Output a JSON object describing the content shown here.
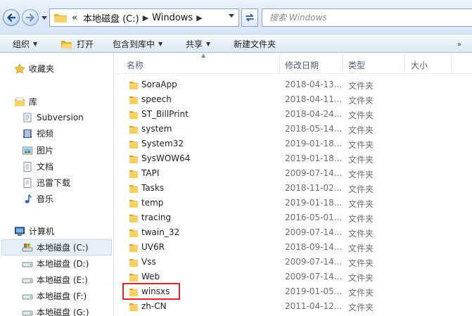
{
  "address": {
    "overflow": "«",
    "breadcrumbs": [
      {
        "label": "本地磁盘 (C:)"
      },
      {
        "label": "Windows"
      }
    ]
  },
  "search": {
    "placeholder": "搜索 Windows"
  },
  "commandbar": {
    "organize": "组织",
    "open": "打开",
    "include_in_library": "包含到库中",
    "share": "共享",
    "new_folder": "新建文件夹"
  },
  "navigation": {
    "favorites": "收藏夹",
    "libraries": "库",
    "library_items": [
      "Subversion",
      "视频",
      "图片",
      "文档",
      "迅雷下载",
      "音乐"
    ],
    "computer": "计算机",
    "drives": [
      "本地磁盘 (C:)",
      "本地磁盘 (D:)",
      "本地磁盘 (E:)",
      "本地磁盘 (F:)",
      "本地磁盘 (G:)"
    ],
    "selected_drive": "本地磁盘 (C:)"
  },
  "columns": {
    "name": "名称",
    "date_modified": "修改日期",
    "type": "类型",
    "size": "大小"
  },
  "files": [
    {
      "name": "SoraApp",
      "date": "2018-04-13...",
      "type": "文件夹"
    },
    {
      "name": "speech",
      "date": "2018-04-11...",
      "type": "文件夹"
    },
    {
      "name": "ST_BillPrint",
      "date": "2018-04-24...",
      "type": "文件夹"
    },
    {
      "name": "system",
      "date": "2018-05-14...",
      "type": "文件夹"
    },
    {
      "name": "System32",
      "date": "2019-01-18...",
      "type": "文件夹"
    },
    {
      "name": "SysWOW64",
      "date": "2019-01-18...",
      "type": "文件夹"
    },
    {
      "name": "TAPI",
      "date": "2009-07-14...",
      "type": "文件夹"
    },
    {
      "name": "Tasks",
      "date": "2018-11-02...",
      "type": "文件夹"
    },
    {
      "name": "temp",
      "date": "2019-01-18...",
      "type": "文件夹"
    },
    {
      "name": "tracing",
      "date": "2016-05-01...",
      "type": "文件夹"
    },
    {
      "name": "twain_32",
      "date": "2009-07-14...",
      "type": "文件夹"
    },
    {
      "name": "UV6R",
      "date": "2018-09-14...",
      "type": "文件夹"
    },
    {
      "name": "Vss",
      "date": "2009-07-14...",
      "type": "文件夹"
    },
    {
      "name": "Web",
      "date": "2009-07-14...",
      "type": "文件夹"
    },
    {
      "name": "winsxs",
      "date": "2019-01-05...",
      "type": "文件夹",
      "highlighted": true
    },
    {
      "name": "zh-CN",
      "date": "2011-04-12...",
      "type": "文件夹"
    }
  ],
  "colors": {
    "highlight_border": "#d9252a",
    "folder_yellow": "#f2c94c",
    "header_text": "#4c607a"
  }
}
